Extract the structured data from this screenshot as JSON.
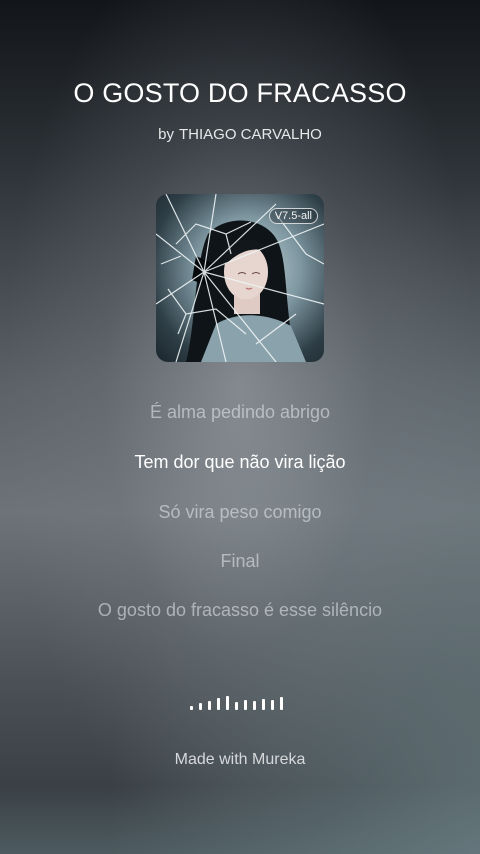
{
  "song": {
    "title": "O GOSTO DO FRACASSO",
    "by_label": "by",
    "artist": "THIAGO CARVALHO"
  },
  "cover": {
    "badge": "V7.5-all",
    "art": "anime-girl-behind-shattered-glass"
  },
  "lyrics": {
    "lines": [
      "É alma pedindo abrigo",
      "Tem dor que não vira lição",
      "Só vira peso comigo",
      "Final",
      "O gosto do fracasso é esse silêncio"
    ],
    "active_index": 1
  },
  "player": {
    "icon": "audio-waveform-icon",
    "bar_levels": [
      0.25,
      0.45,
      0.55,
      0.75,
      0.9,
      0.5,
      0.6,
      0.55,
      0.7,
      0.65,
      0.8
    ]
  },
  "footer": {
    "credit": "Made with Mureka"
  },
  "colors": {
    "text_primary": "#ffffff",
    "text_dimmed": "#c9cdd1"
  }
}
